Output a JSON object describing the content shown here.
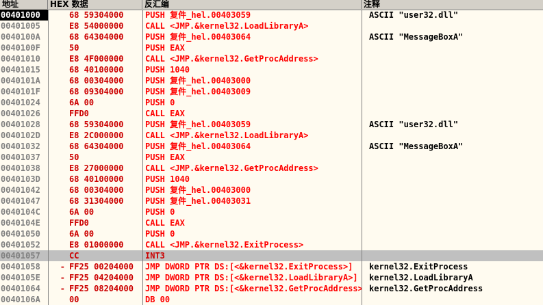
{
  "header": {
    "addr": "地址",
    "hex": "HEX 数据",
    "asm": "反汇编",
    "comment": "注释"
  },
  "rows": [
    {
      "addr": "00401000",
      "pre": "",
      "hex": "68 59304000",
      "asm": "PUSH 复件_hel.00403059",
      "comment": "ASCII \"user32.dll\""
    },
    {
      "addr": "00401005",
      "pre": "",
      "hex": "E8 54000000",
      "asm": "CALL <JMP.&kernel32.LoadLibraryA>",
      "comment": ""
    },
    {
      "addr": "0040100A",
      "pre": "",
      "hex": "68 64304000",
      "asm": "PUSH 复件_hel.00403064",
      "comment": "ASCII \"MessageBoxA\""
    },
    {
      "addr": "0040100F",
      "pre": "",
      "hex": "50",
      "asm": "PUSH EAX",
      "comment": ""
    },
    {
      "addr": "00401010",
      "pre": "",
      "hex": "E8 4F000000",
      "asm": "CALL <JMP.&kernel32.GetProcAddress>",
      "comment": ""
    },
    {
      "addr": "00401015",
      "pre": "",
      "hex": "68 40100000",
      "asm": "PUSH 1040",
      "comment": ""
    },
    {
      "addr": "0040101A",
      "pre": "",
      "hex": "68 00304000",
      "asm": "PUSH 复件_hel.00403000",
      "comment": ""
    },
    {
      "addr": "0040101F",
      "pre": "",
      "hex": "68 09304000",
      "asm": "PUSH 复件_hel.00403009",
      "comment": ""
    },
    {
      "addr": "00401024",
      "pre": "",
      "hex": "6A 00",
      "asm": "PUSH 0",
      "comment": ""
    },
    {
      "addr": "00401026",
      "pre": "",
      "hex": "FFD0",
      "asm": "CALL EAX",
      "comment": ""
    },
    {
      "addr": "00401028",
      "pre": "",
      "hex": "68 59304000",
      "asm": "PUSH 复件_hel.00403059",
      "comment": "ASCII \"user32.dll\""
    },
    {
      "addr": "0040102D",
      "pre": "",
      "hex": "E8 2C000000",
      "asm": "CALL <JMP.&kernel32.LoadLibraryA>",
      "comment": ""
    },
    {
      "addr": "00401032",
      "pre": "",
      "hex": "68 64304000",
      "asm": "PUSH 复件_hel.00403064",
      "comment": "ASCII \"MessageBoxA\""
    },
    {
      "addr": "00401037",
      "pre": "",
      "hex": "50",
      "asm": "PUSH EAX",
      "comment": ""
    },
    {
      "addr": "00401038",
      "pre": "",
      "hex": "E8 27000000",
      "asm": "CALL <JMP.&kernel32.GetProcAddress>",
      "comment": ""
    },
    {
      "addr": "0040103D",
      "pre": "",
      "hex": "68 40100000",
      "asm": "PUSH 1040",
      "comment": ""
    },
    {
      "addr": "00401042",
      "pre": "",
      "hex": "68 00304000",
      "asm": "PUSH 复件_hel.00403000",
      "comment": ""
    },
    {
      "addr": "00401047",
      "pre": "",
      "hex": "68 31304000",
      "asm": "PUSH 复件_hel.00403031",
      "comment": ""
    },
    {
      "addr": "0040104C",
      "pre": "",
      "hex": "6A 00",
      "asm": "PUSH 0",
      "comment": ""
    },
    {
      "addr": "0040104E",
      "pre": "",
      "hex": "FFD0",
      "asm": "CALL EAX",
      "comment": ""
    },
    {
      "addr": "00401050",
      "pre": "",
      "hex": "6A 00",
      "asm": "PUSH 0",
      "comment": ""
    },
    {
      "addr": "00401052",
      "pre": "",
      "hex": "E8 01000000",
      "asm": "CALL <JMP.&kernel32.ExitProcess>",
      "comment": ""
    },
    {
      "addr": "00401057",
      "pre": "",
      "hex": "CC",
      "asm": "INT3",
      "comment": ""
    },
    {
      "addr": "00401058",
      "pre": "-",
      "hex": "FF25 00204000",
      "asm": "JMP DWORD PTR DS:[<&kernel32.ExitProcess>]",
      "comment": "kernel32.ExitProcess"
    },
    {
      "addr": "0040105E",
      "pre": "-",
      "hex": "FF25 04204000",
      "asm": "JMP DWORD PTR DS:[<&kernel32.LoadLibraryA>]",
      "comment": "kernel32.LoadLibraryA"
    },
    {
      "addr": "00401064",
      "pre": "-",
      "hex": "FF25 08204000",
      "asm": "JMP DWORD PTR DS:[<&kernel32.GetProcAddress>]",
      "comment": "kernel32.GetProcAddress"
    },
    {
      "addr": "0040106A",
      "pre": "",
      "hex": "00",
      "asm": "DB 00",
      "comment": ""
    }
  ],
  "current_row": 0,
  "selected_row": 22
}
